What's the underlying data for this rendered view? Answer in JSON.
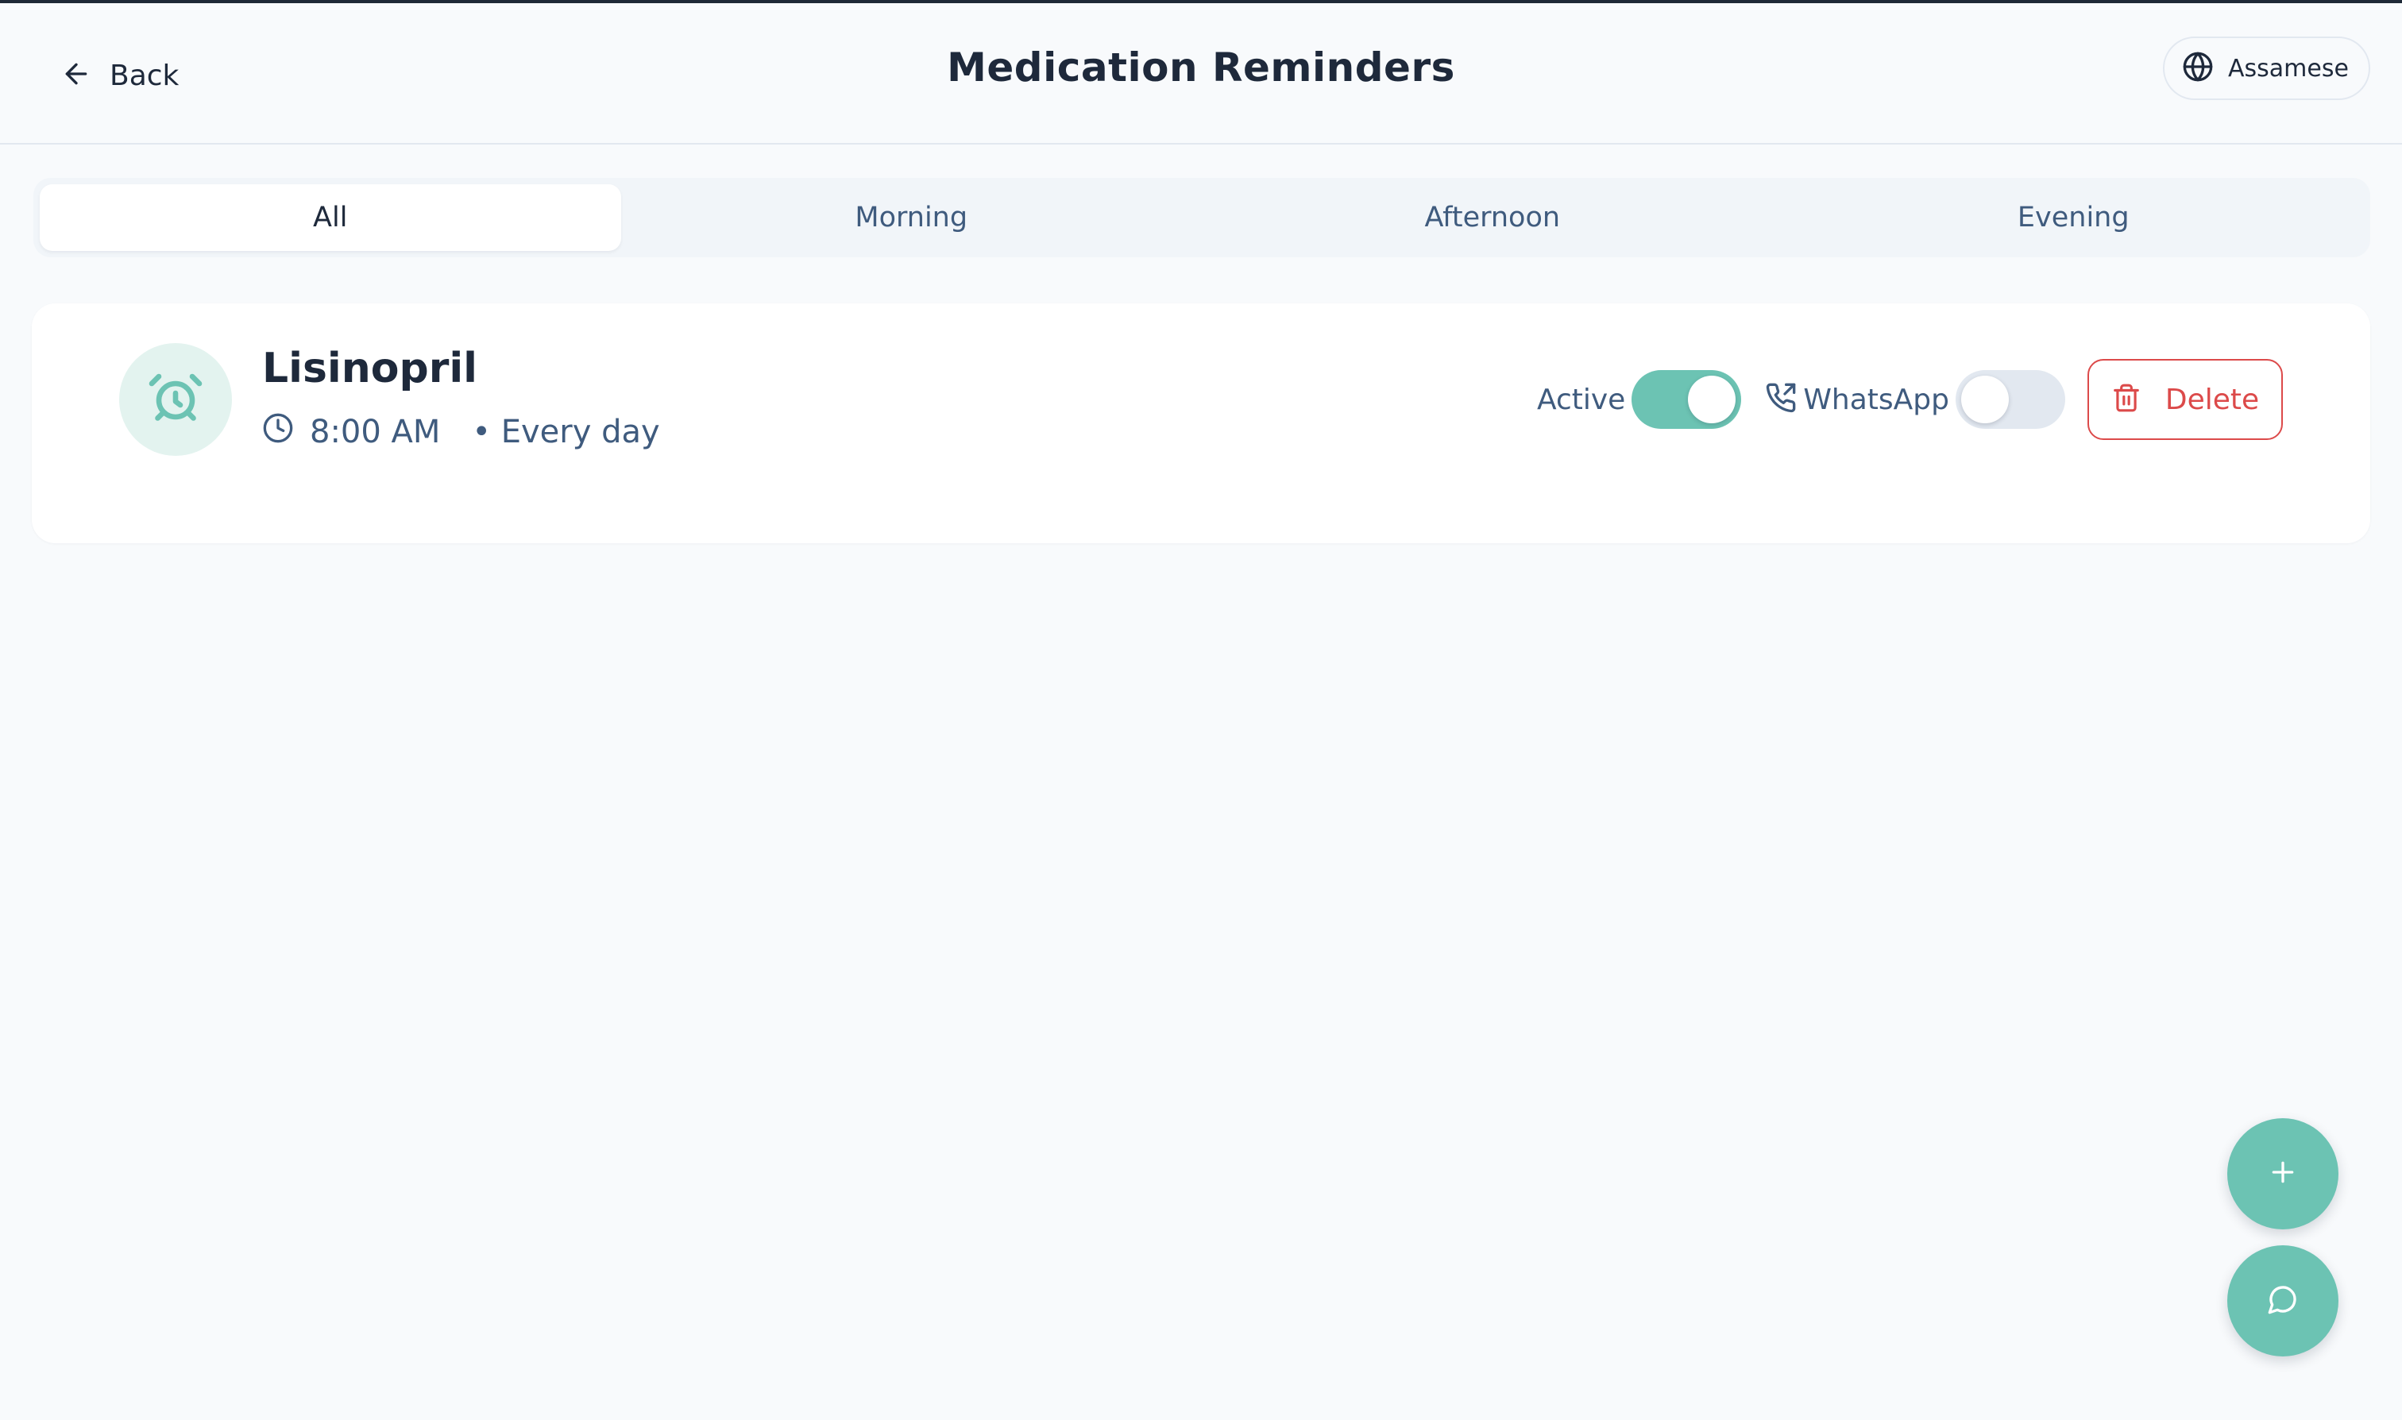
{
  "header": {
    "back_label": "Back",
    "title": "Medication Reminders",
    "language_label": "Assamese"
  },
  "tabs": [
    {
      "label": "All",
      "active": true
    },
    {
      "label": "Morning",
      "active": false
    },
    {
      "label": "Afternoon",
      "active": false
    },
    {
      "label": "Evening",
      "active": false
    }
  ],
  "reminders": [
    {
      "icon": "alarm-clock-icon",
      "name": "Lisinopril",
      "time": "8:00 AM",
      "frequency": "• Every day",
      "active_label": "Active",
      "active": true,
      "whatsapp_label": "WhatsApp",
      "whatsapp": false,
      "delete_label": "Delete"
    }
  ],
  "fabs": [
    {
      "icon": "plus-icon"
    },
    {
      "icon": "chat-bubble-icon"
    }
  ],
  "colors": {
    "accent": "#6cc3b3",
    "accent_light": "#e3f3ef",
    "danger": "#dc4a4a",
    "text_primary": "#1e293b",
    "text_secondary": "#3f5b7e",
    "background": "#f8fafc",
    "border": "#e2e8f0"
  }
}
